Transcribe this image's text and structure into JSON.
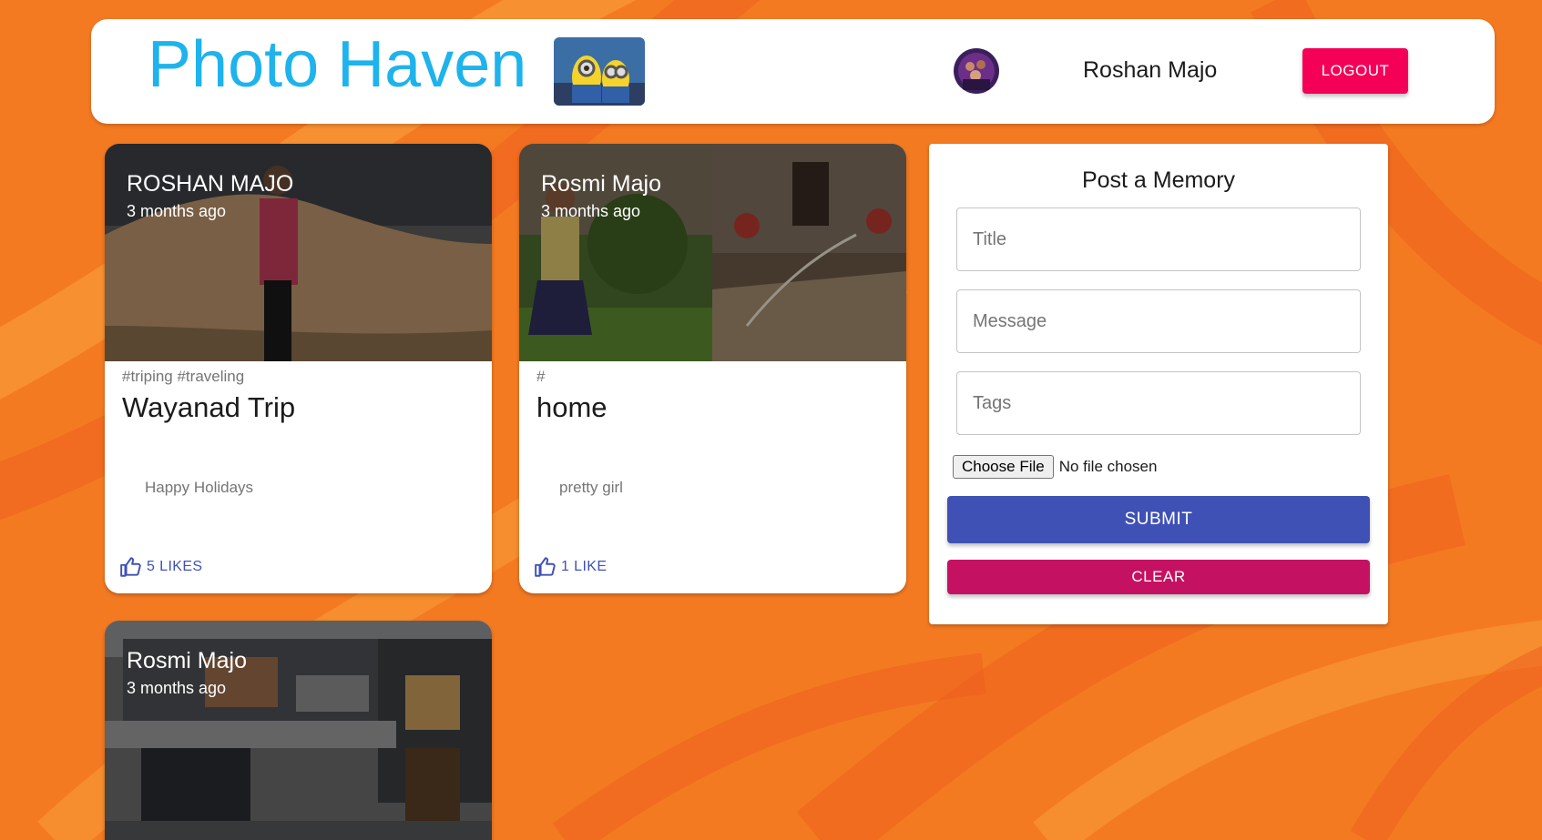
{
  "header": {
    "brand": "Photo Haven",
    "user_name": "Roshan Majo",
    "logout_label": "LOGOUT"
  },
  "posts": [
    {
      "author": "ROSHAN MAJO",
      "time": "3 months ago",
      "tags": "#triping #traveling",
      "title": "Wayanad Trip",
      "message": "Happy Holidays",
      "likes": "5 LIKES"
    },
    {
      "author": "Rosmi Majo",
      "time": "3 months ago",
      "tags": "#",
      "title": "home",
      "message": "pretty girl",
      "likes": "1 LIKE"
    },
    {
      "author": "Rosmi Majo",
      "time": "3 months ago"
    }
  ],
  "form": {
    "heading": "Post a Memory",
    "title_placeholder": "Title",
    "message_placeholder": "Message",
    "tags_placeholder": "Tags",
    "file_button": "Choose File",
    "file_status": "No file chosen",
    "submit_label": "SUBMIT",
    "clear_label": "CLEAR"
  },
  "colors": {
    "background": "#f47a22",
    "brand": "#1eb3ec",
    "logout": "#f50057",
    "submit": "#3f51b5",
    "clear": "#c51162",
    "like": "#3f51b5"
  },
  "icons": [
    "thumb-up-icon"
  ]
}
